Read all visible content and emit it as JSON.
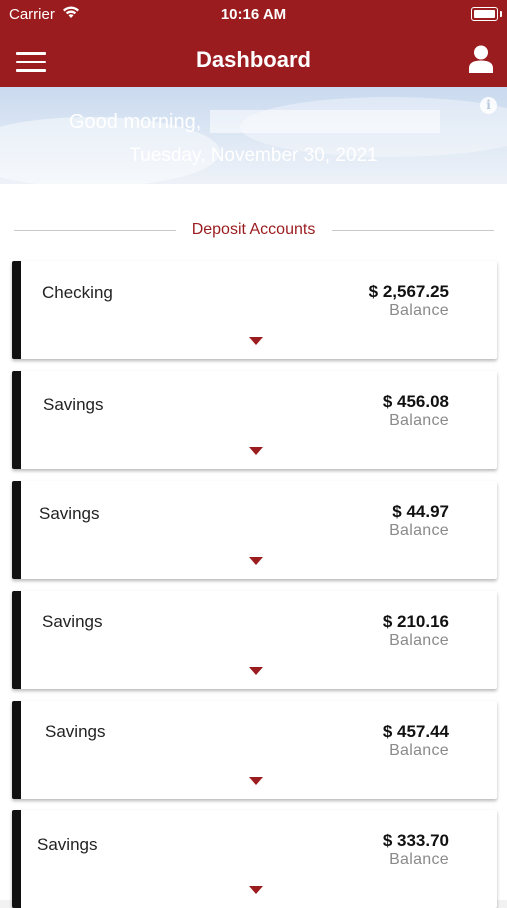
{
  "status_bar": {
    "carrier": "Carrier",
    "time": "10:16 AM"
  },
  "nav": {
    "title": "Dashboard"
  },
  "hero": {
    "greeting": "Good morning,",
    "date": "Tuesday, November 30, 2021"
  },
  "section": {
    "title": "Deposit Accounts"
  },
  "accounts": [
    {
      "name": "Checking",
      "amount": "$ 2,567.25",
      "balance_label": "Balance"
    },
    {
      "name": "Savings",
      "amount": "$ 456.08",
      "balance_label": "Balance"
    },
    {
      "name": "Savings",
      "amount": "$ 44.97",
      "balance_label": "Balance"
    },
    {
      "name": "Savings",
      "amount": "$ 210.16",
      "balance_label": "Balance"
    },
    {
      "name": "Savings",
      "amount": "$ 457.44",
      "balance_label": "Balance"
    },
    {
      "name": "Savings",
      "amount": "$ 333.70",
      "balance_label": "Balance"
    }
  ],
  "icons": {
    "menu": "hamburger-menu-icon",
    "profile": "user-icon",
    "info": "info-icon",
    "expand": "caret-down-icon",
    "wifi": "wifi-icon",
    "battery": "battery-icon"
  },
  "colors": {
    "brand": "#9b1c1f",
    "card_accent": "#111111",
    "muted_text": "#8a8a8a"
  }
}
